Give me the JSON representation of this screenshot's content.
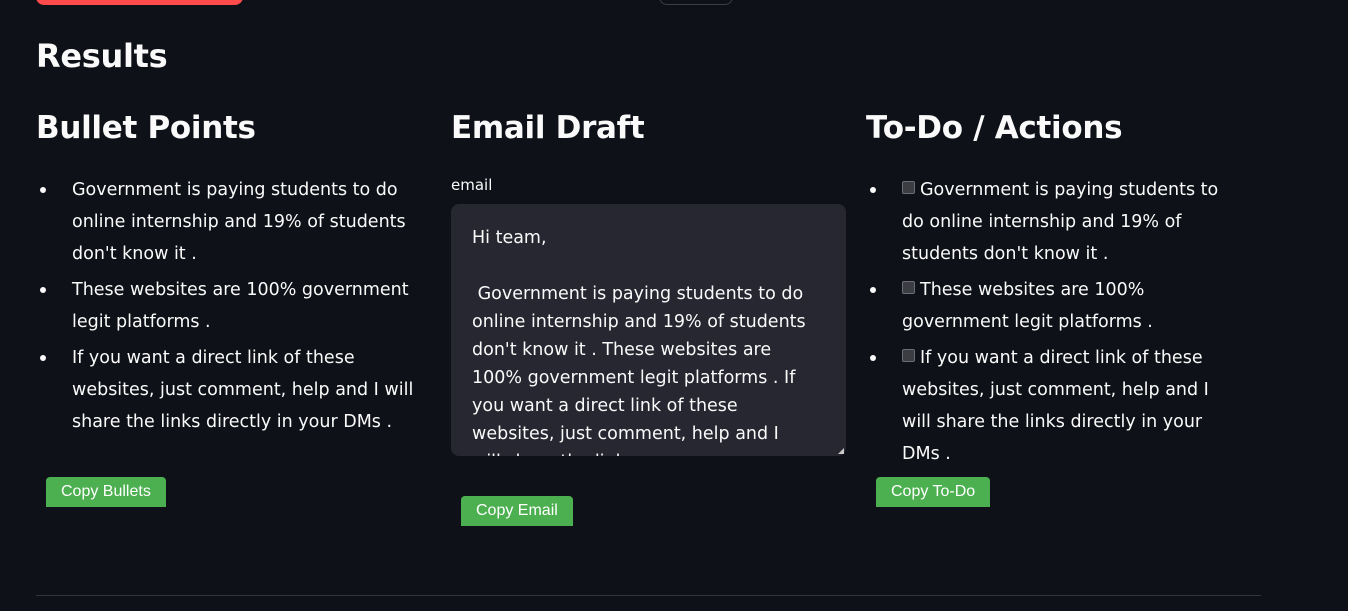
{
  "results_title": "Results",
  "bullets": {
    "heading": "Bullet Points",
    "items": [
      "Government is paying students to do online internship and 19% of students don't know it .",
      "These websites are 100% government legit platforms .",
      "If you want a direct link of these websites, just comment, help and I will share the links directly in your DMs ."
    ],
    "copy_label": "Copy Bullets"
  },
  "email": {
    "heading": "Email Draft",
    "field_label": "email",
    "value": "Hi team,\n\n Government is paying students to do online internship and 19% of students don't know it . These websites are 100% government legit platforms . If you want a direct link of these websites, just comment, help and I will share the links",
    "copy_label": "Copy Email"
  },
  "todo": {
    "heading": "To-Do / Actions",
    "items": [
      "Government is paying students to do online internship and 19% of students don't know it .",
      "These websites are 100% government legit platforms .",
      "If you want a direct link of these websites, just comment, help and I will share the links directly in your DMs ."
    ],
    "copy_label": "Copy To-Do"
  },
  "colors": {
    "background": "#0e1117",
    "button_green": "#4caf50",
    "textarea_bg": "#262730",
    "top_button_red": "#ff4b4b"
  }
}
